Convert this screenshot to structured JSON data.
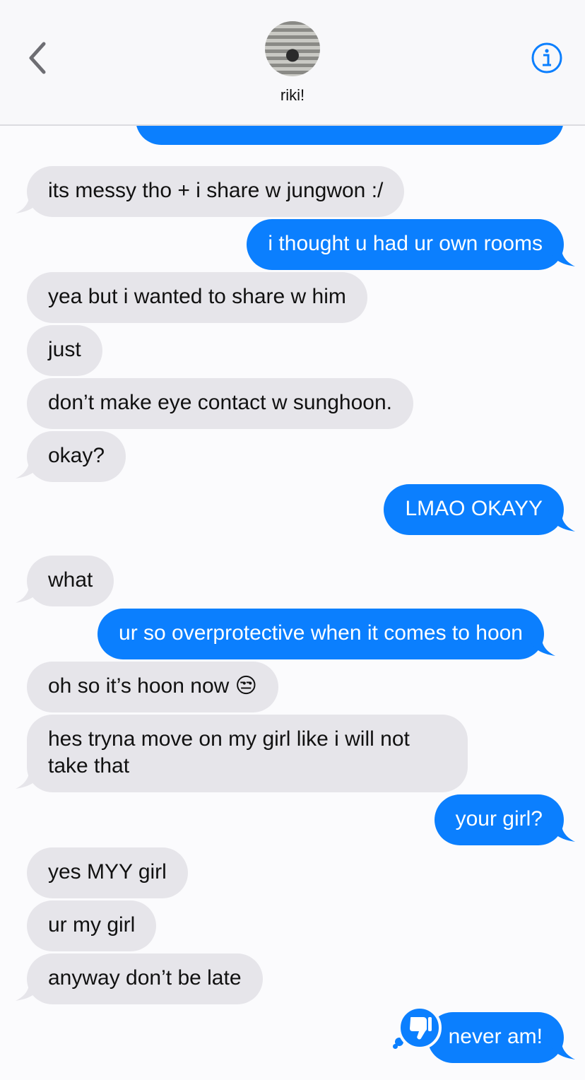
{
  "header": {
    "contact_name": "riki!",
    "back_icon": "chevron-left-icon",
    "info_icon": "info-icon"
  },
  "colors": {
    "outgoing": "#0b7ffe",
    "incoming": "#e6e5ea"
  },
  "messages": [
    {
      "from": "them",
      "text": "its messy tho + i share w jungwon :/"
    },
    {
      "from": "me",
      "text": "i thought u had ur own rooms"
    },
    {
      "from": "them",
      "text": "yea but i wanted to share w him"
    },
    {
      "from": "them",
      "text": "just"
    },
    {
      "from": "them",
      "text": "don’t make eye contact w sunghoon."
    },
    {
      "from": "them",
      "text": "okay?"
    },
    {
      "from": "me",
      "text": "LMAO OKAYY"
    },
    {
      "from": "them",
      "text": "what"
    },
    {
      "from": "me",
      "text": "ur so overprotective when it comes to hoon"
    },
    {
      "from": "them",
      "text": "oh so it’s hoon now 😒"
    },
    {
      "from": "them",
      "text": "hes tryna move on my girl like i will not take that"
    },
    {
      "from": "me",
      "text": "your girl?"
    },
    {
      "from": "them",
      "text": "yes MYY girl"
    },
    {
      "from": "them",
      "text": "ur my girl"
    },
    {
      "from": "them",
      "text": "anyway don’t be late"
    },
    {
      "from": "me",
      "text": "never am!",
      "reaction": "thumbs-down-icon"
    }
  ]
}
